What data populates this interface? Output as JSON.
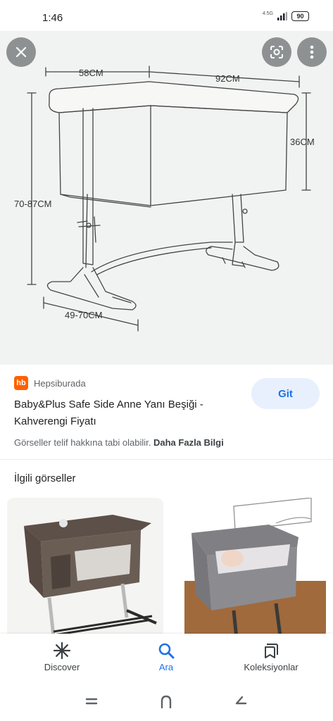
{
  "status": {
    "time": "1:46",
    "network": "4.5G",
    "battery": "90"
  },
  "viewer": {
    "dimensions": {
      "width_top": "58CM",
      "length_top": "92CM",
      "depth": "36CM",
      "height": "70-87CM",
      "base": "49-70CM"
    }
  },
  "result": {
    "source_name": "Hepsiburada",
    "source_logo": "hb",
    "visit_label": "Git",
    "title": "Baby&Plus Safe Side Anne Yanı Beşiği - Kahverengi Fiyatı",
    "copyright_text": "Görseller telif hakkına tabi olabilir.",
    "more_info": "Daha Fazla Bilgi"
  },
  "related": {
    "heading": "İlgili görseller"
  },
  "bottom_nav": {
    "items": [
      {
        "label": "Discover",
        "icon": "asterisk-icon"
      },
      {
        "label": "Ara",
        "icon": "search-icon"
      },
      {
        "label": "Koleksiyonlar",
        "icon": "collections-icon"
      }
    ]
  },
  "colors": {
    "accent": "#1a73e8",
    "visit_bg": "#e8f0fe",
    "brand": "#ff6000"
  }
}
